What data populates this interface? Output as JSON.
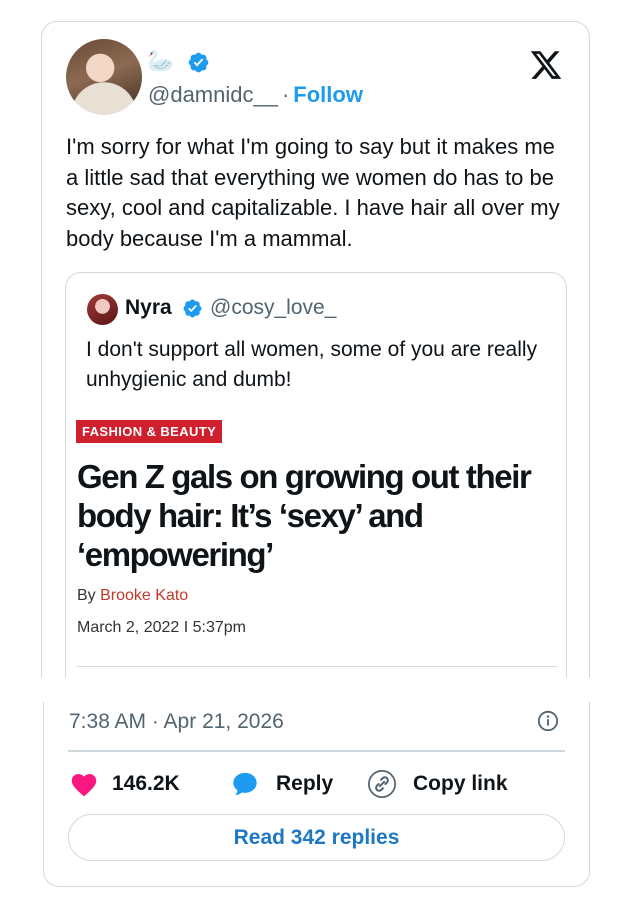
{
  "tweet": {
    "emoji": "🦢",
    "handle": "@damnidc__",
    "separator": "·",
    "follow_label": "Follow",
    "text": "I'm sorry for what I'm going to say but it makes me a little sad that everything we women do has to be sexy, cool and capitalizable. I have hair all over my body because I'm a mammal.",
    "timestamp": "7:38 AM · Apr 21, 2026"
  },
  "quoted": {
    "name": "Nyra",
    "handle": "@cosy_love_",
    "text": "I don't support all women, some of you are really unhygienic and dumb!",
    "article": {
      "tag": "FASHION & BEAUTY",
      "headline": "Gen Z gals on growing out their body hair: It’s ‘sexy’ and ‘empowering’",
      "by": "By",
      "author": "Brooke Kato",
      "date": "March 2, 2022 I 5:37pm"
    }
  },
  "actions": {
    "like_count": "146.2K",
    "reply_label": "Reply",
    "copy_label": "Copy link",
    "read_replies_label": "Read 342 replies"
  },
  "colors": {
    "accent_blue": "#1d9bf0",
    "like_pink": "#f91880",
    "tag_red": "#d0202e",
    "border": "#cfd9de"
  },
  "icons": [
    "verified-badge-icon",
    "x-logo-icon",
    "info-icon",
    "heart-icon",
    "reply-bubble-icon",
    "link-icon"
  ]
}
